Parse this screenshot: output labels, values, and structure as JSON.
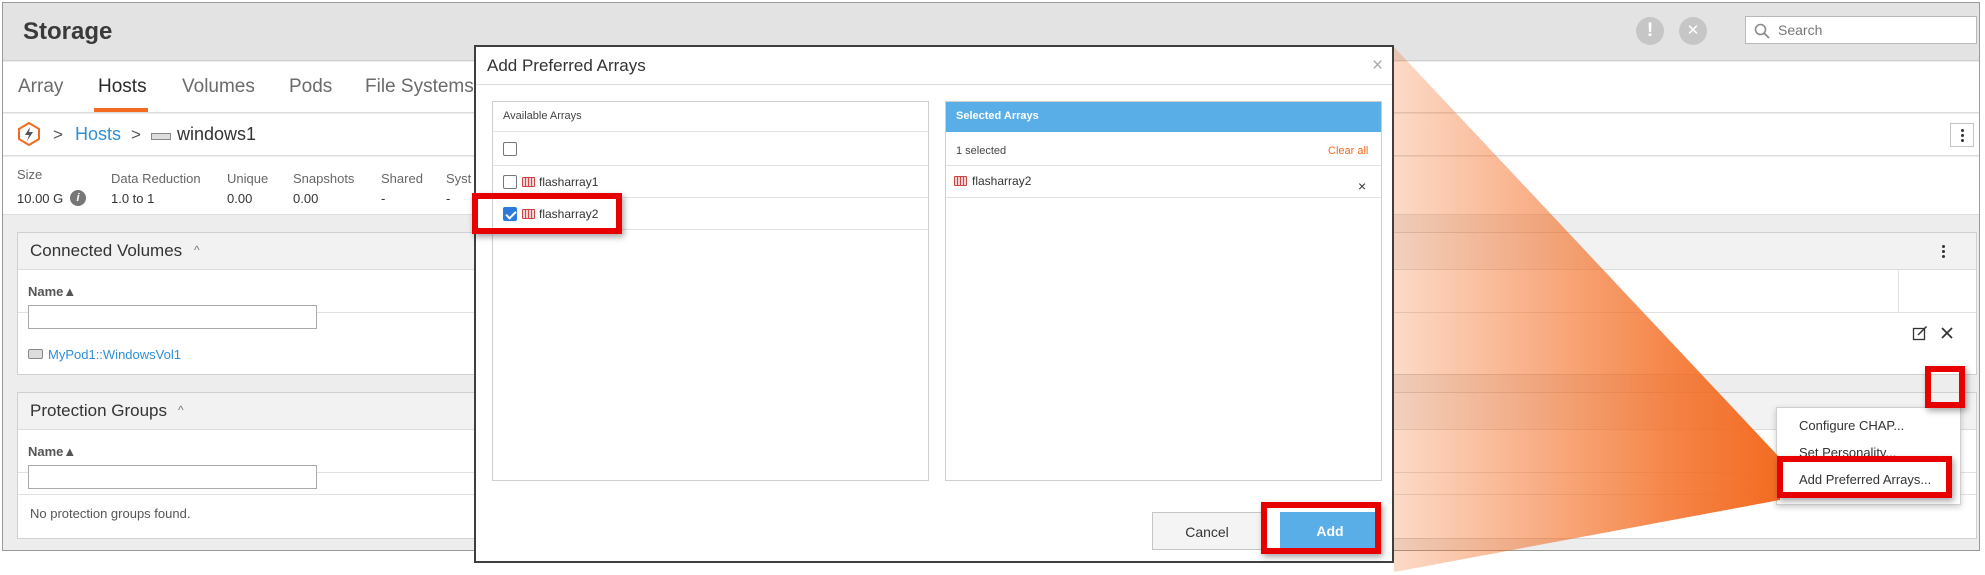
{
  "header": {
    "title": "Storage",
    "search_placeholder": "Search",
    "alert_glyph": "!",
    "close_glyph": "✕"
  },
  "tabs": [
    {
      "label": "Array"
    },
    {
      "label": "Hosts",
      "active": true
    },
    {
      "label": "Volumes"
    },
    {
      "label": "Pods"
    },
    {
      "label": "File Systems"
    }
  ],
  "breadcrumb": {
    "separator": ">",
    "hosts": "Hosts",
    "host": "windows1"
  },
  "stats": [
    {
      "label": "Size",
      "value": "10.00 G"
    },
    {
      "label": "Data Reduction",
      "value": "1.0 to 1"
    },
    {
      "label": "Unique",
      "value": "0.00"
    },
    {
      "label": "Snapshots",
      "value": "0.00"
    },
    {
      "label": "Shared",
      "value": "-"
    },
    {
      "label": "Syst",
      "value": "-"
    }
  ],
  "connected_volumes": {
    "title": "Connected Volumes",
    "caret": "^",
    "column": "Name▲",
    "rows": [
      {
        "name": "MyPod1::WindowsVol1"
      }
    ]
  },
  "protection_groups": {
    "title": "Protection Groups",
    "caret": "^",
    "column": "Name▲",
    "empty": "No protection groups found."
  },
  "dialog": {
    "title": "Add Preferred Arrays",
    "close_glyph": "×",
    "available": {
      "title": "Available Arrays",
      "items": [
        {
          "name": "flasharray1",
          "checked": false
        },
        {
          "name": "flasharray2",
          "checked": true
        }
      ]
    },
    "selected": {
      "title": "Selected Arrays",
      "count": "1 selected",
      "clear": "Clear all",
      "items": [
        {
          "name": "flasharray2"
        }
      ],
      "remove_glyph": "×"
    },
    "cancel": "Cancel",
    "add": "Add"
  },
  "menu": {
    "items": [
      {
        "label": "Configure CHAP..."
      },
      {
        "label": "Set Personality..."
      },
      {
        "label": "Add Preferred Arrays..."
      }
    ]
  },
  "colors": {
    "accent": "#f36b21",
    "link": "#2e8fd6",
    "primary_button": "#5aaee8",
    "highlight": "#e60000"
  }
}
